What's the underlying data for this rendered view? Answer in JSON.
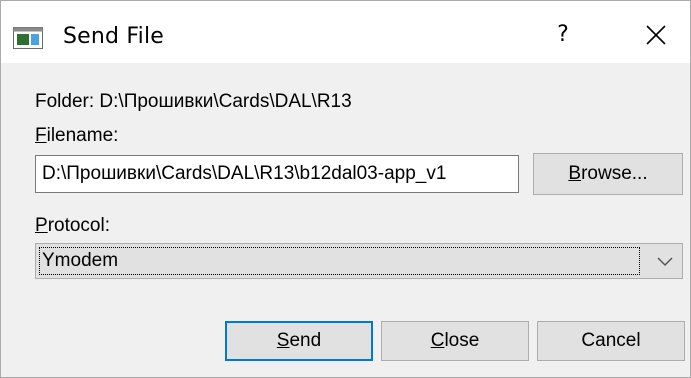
{
  "window": {
    "title": "Send File",
    "help_label": "?",
    "close_icon": "close-x-icon",
    "app_icon": "window-app-icon"
  },
  "folder": {
    "text": "Folder:  D:\\Прошивки\\Cards\\DAL\\R13"
  },
  "filename": {
    "label_mnemonic": "F",
    "label_rest": "ilename:",
    "value": "D:\\Прошивки\\Cards\\DAL\\R13\\b12dal03-app_v1",
    "browse_mnemonic": "B",
    "browse_rest": "rowse..."
  },
  "protocol": {
    "label_mnemonic": "P",
    "label_rest": "rotocol:",
    "selected": "Ymodem",
    "dropdown_icon": "chevron-down-icon"
  },
  "buttons": {
    "send_mnemonic": "S",
    "send_rest": "end",
    "close_mnemonic": "C",
    "close_rest": "lose",
    "cancel": "Cancel"
  },
  "colors": {
    "default_button_border": "#0078d7",
    "dialog_bg": "#f0f0f0",
    "titlebar_bg": "#ffffff"
  }
}
